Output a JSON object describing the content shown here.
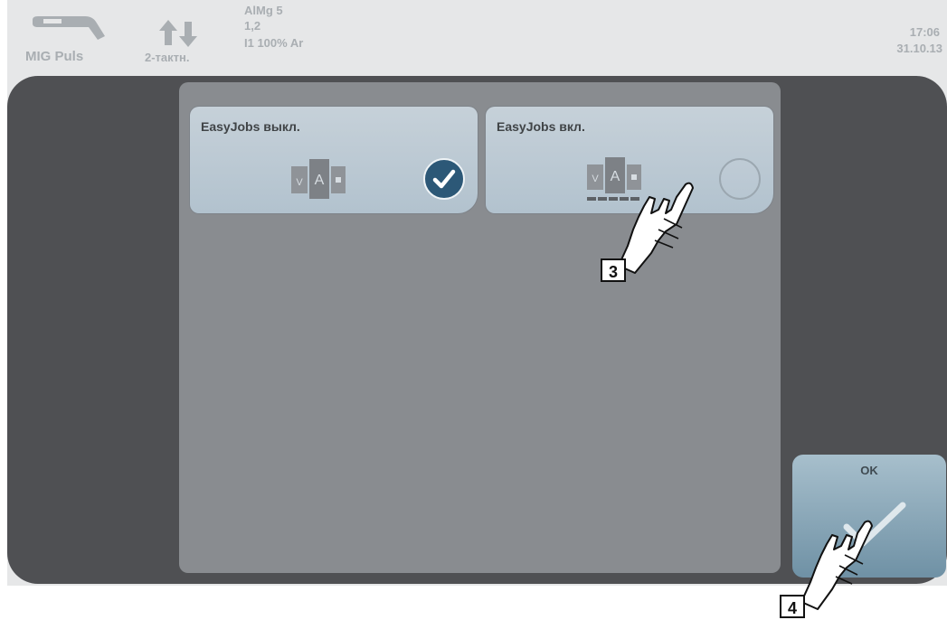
{
  "status_bar": {
    "process_mode": "MIG Puls",
    "trigger_mode": "2-тактн.",
    "material": "AlMg 5",
    "wire_diameter": "1,2",
    "gas": "I1 100% Ar",
    "time": "17:06",
    "date": "31.10.13"
  },
  "options": [
    {
      "label": "EasyJobs выкл.",
      "selected": true
    },
    {
      "label": "EasyJobs вкл.",
      "selected": false
    }
  ],
  "ok_button": {
    "label": "OK"
  },
  "callouts": {
    "step_3": "3",
    "step_4": "4"
  },
  "colors": {
    "dark_frame": "#4f5053",
    "panel": "#898c90",
    "selected_check": "#2c5877",
    "status_text": "#a9aeb2"
  }
}
